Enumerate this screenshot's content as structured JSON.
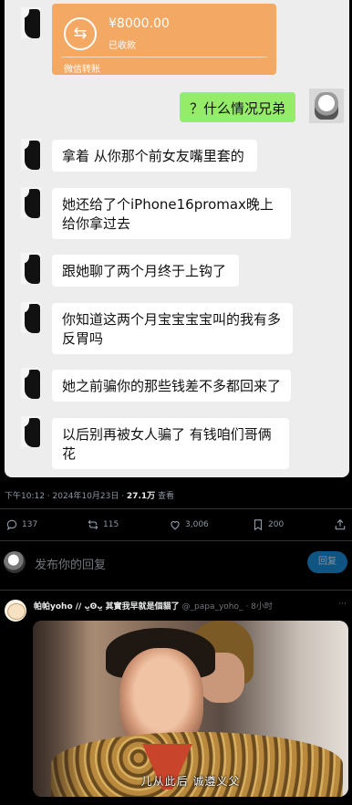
{
  "chat": {
    "transfer": {
      "amount": "¥8000.00",
      "status": "已收款",
      "footer": "微信转账",
      "icon": "transfer-arrows-icon"
    },
    "messages": [
      {
        "side": "right",
        "text": "？什么情况兄弟"
      },
      {
        "side": "left",
        "text": "拿着 从你那个前女友嘴里套的"
      },
      {
        "side": "left",
        "text": "她还给了个iPhone16promax晚上给你拿过去"
      },
      {
        "side": "left",
        "text": "跟她聊了两个月终于上钩了"
      },
      {
        "side": "left",
        "text": "你知道这两个月宝宝宝宝叫的我有多反胃吗"
      },
      {
        "side": "left",
        "text": "她之前骗你的那些钱差不多都回来了"
      },
      {
        "side": "left",
        "text": "以后别再被女人骗了 有钱咱们哥俩花"
      }
    ]
  },
  "tweet": {
    "timestamp": "下午10:12 · 2024年10月23日 · ",
    "views": "27.1万",
    "views_label": " 查看",
    "replies": "137",
    "reposts": "115",
    "likes": "3,006",
    "bookmarks": "200"
  },
  "reply_box": {
    "placeholder": "发布你的回复",
    "button": "回复"
  },
  "reply": {
    "name": "帕帕yoho // ᴗ̤Ꙩᴗ̤ 其實我早就是個貓了",
    "handle": "@_papa_yoho_ · 8小时",
    "more": "···",
    "subtitle": "儿从此后 诚遵义父"
  },
  "colors": {
    "chat_bg": "#ededed",
    "bubble_green": "#95ec69",
    "transfer_orange": "#f3a864",
    "link_blue": "#1d9bf0",
    "muted": "#71767b"
  }
}
